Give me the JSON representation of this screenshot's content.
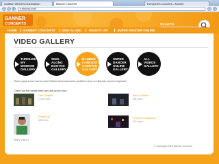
{
  "browser": {
    "tabs": [
      {
        "label": "Audition Winners Dulubsahan"
      },
      {
        "label": "Banner Concerts"
      },
      {
        "label": "Everyone's Concerts - Archive"
      }
    ],
    "url": "rurhumy.com/"
  },
  "site": {
    "logo_text": "BANNER CONCERTS",
    "nav": [
      "HOME",
      "BANNER CONCERTS",
      "SING-ALONG",
      "MASH IT UP!",
      "SUPER DANCER ONLINE"
    ],
    "search_label": "SEARCH",
    "search_placeholder": ""
  },
  "gallery": {
    "title": "VIDEO GALLERY",
    "categories": [
      {
        "label": "THROUGH MY WINDOW GALLERY"
      },
      {
        "label": "SING-ALONG BOOTHS GALLERY"
      },
      {
        "label": "BANNER CONCERTS AUDITION GALLERY"
      },
      {
        "label": "SUPER DANCER ONLINE GALLERY"
      },
      {
        "label": "ALL VIDEOS GALLERY"
      }
    ],
    "intro": "These guys know how to rock! Watch these awesome auditions from our Banner concert hopefuls!",
    "check_out": "Check out the bands here who are up for your:",
    "videos": [
      {
        "title": "Last Chapter",
        "meta": "1 323 views"
      },
      {
        "title": "Wild Lullabies",
        "meta": "668 views"
      },
      {
        "title": "Street Kid",
        "meta": "583 views"
      },
      {
        "title": "Product Vengeance",
        "meta": "419 views"
      }
    ],
    "pagination": "PREV | NEXT",
    "copyright": "© Copyright 2009 Banner Concerts"
  }
}
